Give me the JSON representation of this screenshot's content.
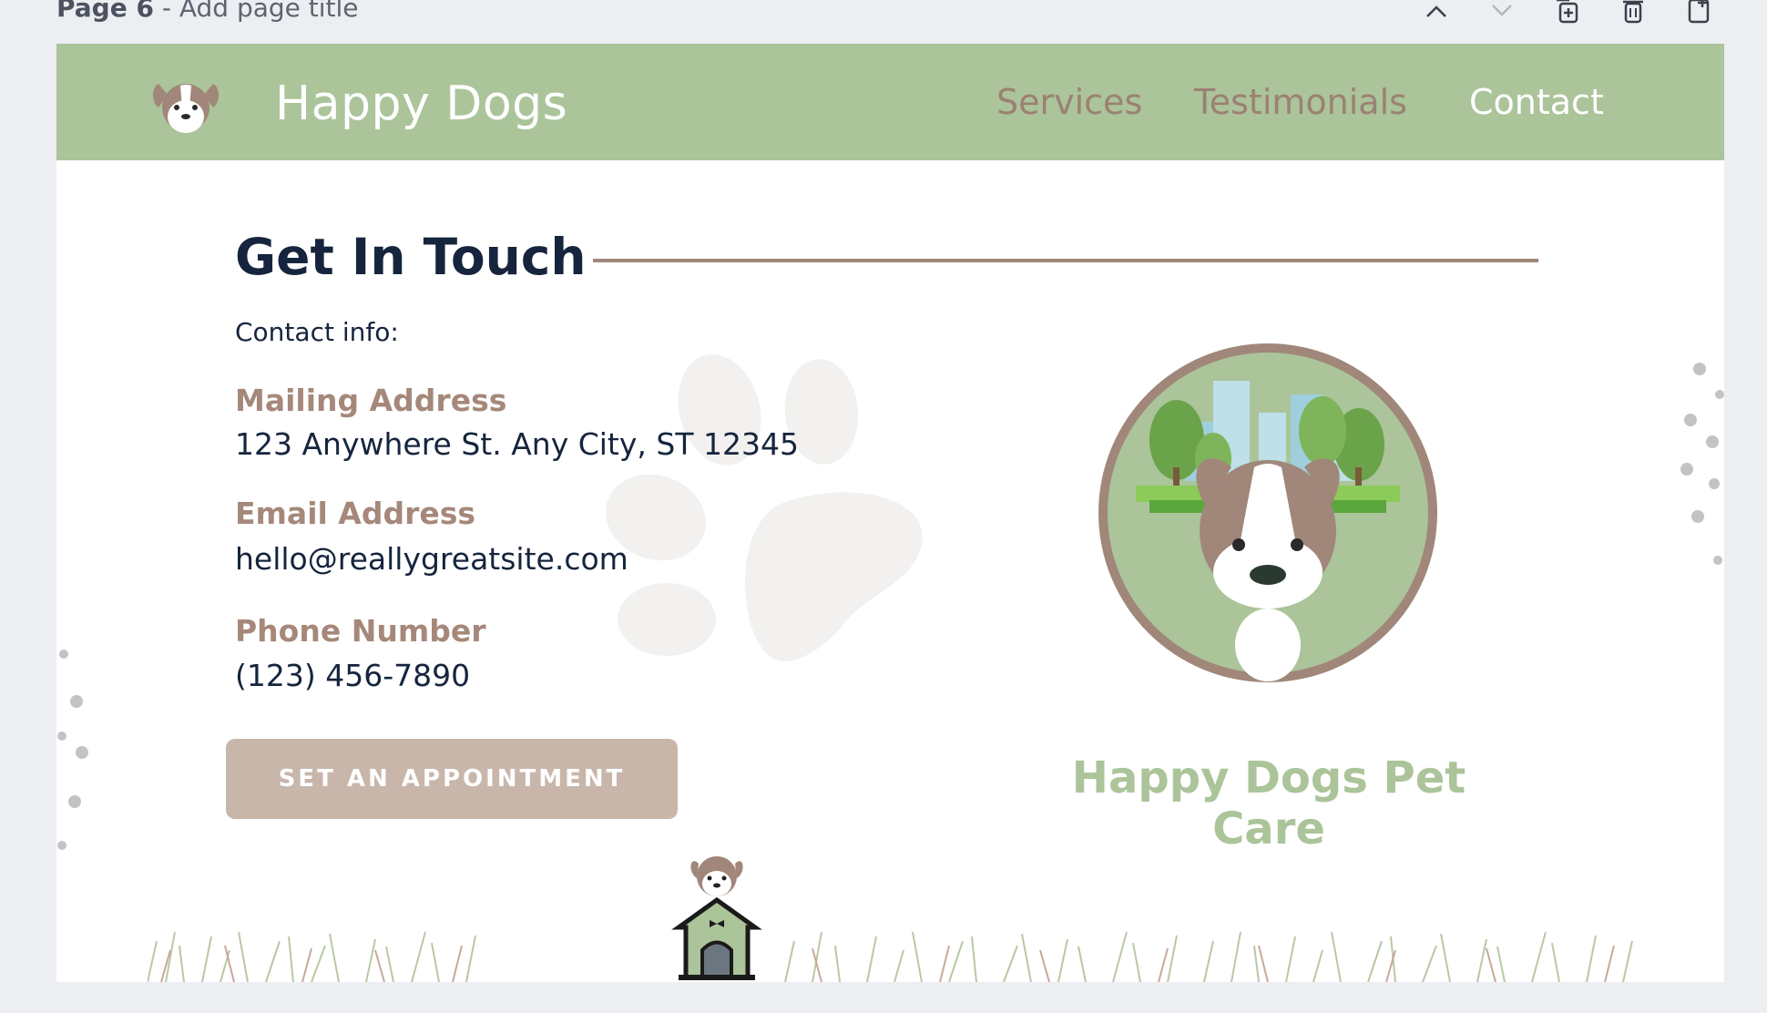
{
  "editor": {
    "page_number": "Page 6",
    "page_title_placeholder": "- Add page title",
    "tools": [
      "chevron-up-icon",
      "chevron-down-icon",
      "duplicate-page-icon",
      "trash-icon",
      "add-page-icon"
    ]
  },
  "header": {
    "brand": "Happy Dogs",
    "nav": [
      {
        "label": "Services",
        "active": false
      },
      {
        "label": "Testimonials",
        "active": false
      },
      {
        "label": "Contact",
        "active": true
      }
    ],
    "bg_color": "#abc49a"
  },
  "main": {
    "heading": "Get In Touch",
    "contact_info_label": "Contact info:",
    "fields": [
      {
        "label": "Mailing Address",
        "value": "123 Anywhere St. Any City, ST 12345"
      },
      {
        "label": "Email Address",
        "value": "hello@reallygreatsite.com"
      },
      {
        "label": "Phone Number",
        "value": "(123) 456-7890"
      }
    ],
    "cta_label": "SET AN APPOINTMENT",
    "tagline": "Happy Dogs Pet Care"
  },
  "colors": {
    "green": "#abc49a",
    "brown": "#a0877a",
    "navy": "#16253d",
    "button": "#c8b6ab"
  }
}
